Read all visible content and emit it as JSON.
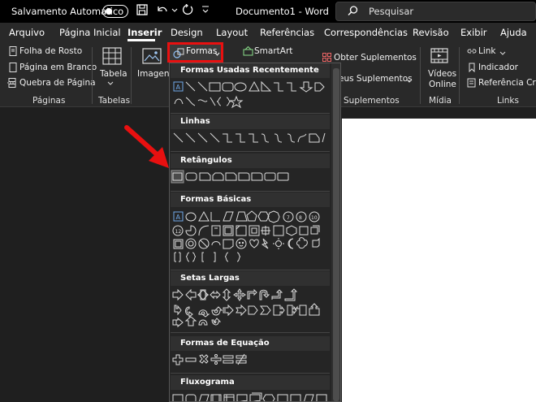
{
  "titlebar": {
    "autosave_label": "Salvamento Automático",
    "document_title": "Documento1  -  Word",
    "search_placeholder": "Pesquisar"
  },
  "tabs": [
    {
      "label": "Arquivo"
    },
    {
      "label": "Página Inicial"
    },
    {
      "label": "Inserir"
    },
    {
      "label": "Design"
    },
    {
      "label": "Layout"
    },
    {
      "label": "Referências"
    },
    {
      "label": "Correspondências"
    },
    {
      "label": "Revisão"
    },
    {
      "label": "Exibir"
    },
    {
      "label": "Ajuda"
    }
  ],
  "ribbon": {
    "paginas": {
      "folha_de_rosto": "Folha de Rosto",
      "pagina_em_branco": "Página em Branco",
      "quebra_de_pagina": "Quebra de Página",
      "group": "Páginas"
    },
    "tabelas": {
      "tabela": "Tabela",
      "group": "Tabelas"
    },
    "imagens": "Imagens",
    "formas": "Formas",
    "smartart": "SmartArt",
    "suplementos": {
      "obter": "Obter Suplementos",
      "meus": "eus Suplementos",
      "group": "Suplementos"
    },
    "midia": {
      "videos_line1": "Vídeos",
      "videos_line2": "Online",
      "group": "Mídia"
    },
    "links": {
      "link": "Link",
      "indicador": "Indicador",
      "referencia": "Referência Cruza",
      "group": "Links"
    }
  },
  "dropdown": {
    "sections": [
      {
        "title": "Formas Usadas Recentemente"
      },
      {
        "title": "Linhas"
      },
      {
        "title": "Retângulos"
      },
      {
        "title": "Formas Básicas"
      },
      {
        "title": "Setas Largas"
      },
      {
        "title": "Formas de Equação"
      },
      {
        "title": "Fluxograma"
      }
    ]
  },
  "colors": {
    "highlight": "#e81010",
    "titlebar_bg": "#000000",
    "ribbon_bg": "#292929",
    "dropdown_bg": "#252525"
  }
}
